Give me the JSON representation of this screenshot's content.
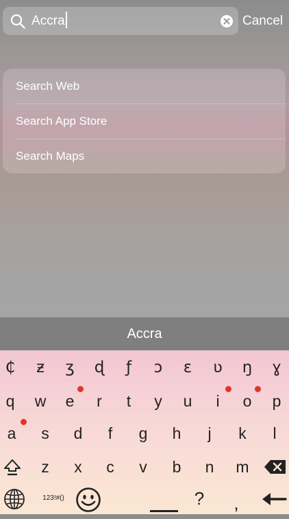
{
  "search": {
    "query": "Accra",
    "cancel_label": "Cancel"
  },
  "suggestions": [
    {
      "label": "Search Web"
    },
    {
      "label": "Search App Store"
    },
    {
      "label": "Search Maps"
    }
  ],
  "prediction": "Accra",
  "keyboard": {
    "row_special": [
      "₵",
      "ƶ",
      "ʒ",
      "ɖ",
      "ƒ",
      "ɔ",
      "ɛ",
      "ʋ",
      "ŋ",
      "ɣ"
    ],
    "row1": [
      "q",
      "w",
      "e",
      "r",
      "t",
      "y",
      "u",
      "i",
      "o",
      "p"
    ],
    "row2": [
      "a",
      "s",
      "d",
      "f",
      "g",
      "h",
      "j",
      "k",
      "l"
    ],
    "row3": [
      "z",
      "x",
      "c",
      "v",
      "b",
      "n",
      "m"
    ],
    "numbers_label": "123!#()",
    "question_label": "?",
    "comma_label": ","
  },
  "colors": {
    "accent_dot": "#e0352b",
    "prediction_bar": "#7f7f7f"
  }
}
